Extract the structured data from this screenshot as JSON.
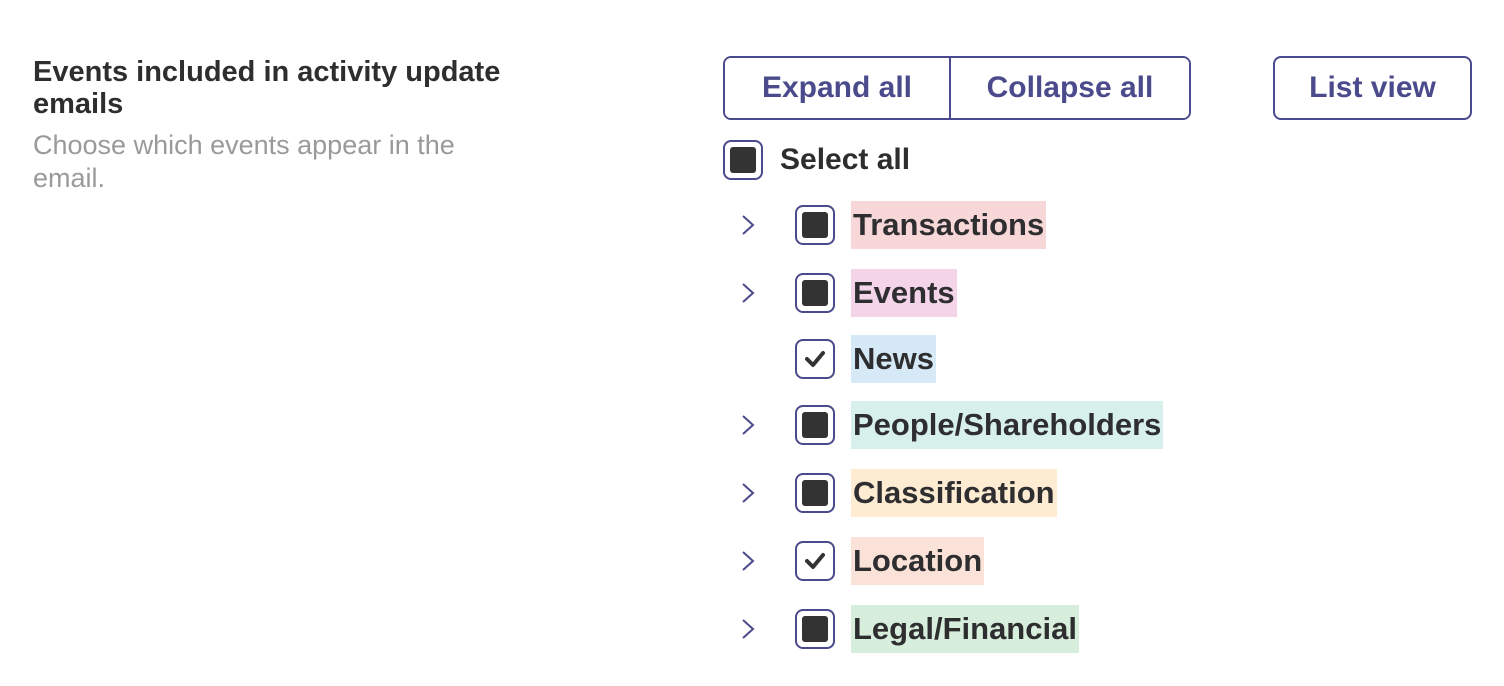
{
  "section": {
    "title": "Events included in activity update emails",
    "subtitle": "Choose which events appear in the email."
  },
  "toolbar": {
    "expand_all": "Expand all",
    "collapse_all": "Collapse all",
    "list_view": "List view"
  },
  "select_all": {
    "label": "Select all",
    "state": "indeterminate"
  },
  "colors": {
    "accent": "#4a4a8c",
    "text": "#2e2e30",
    "muted": "#9a9a9a"
  },
  "categories": [
    {
      "label": "Transactions",
      "state": "indeterminate",
      "expandable": true,
      "color": "#f8d7d8"
    },
    {
      "label": "Events",
      "state": "indeterminate",
      "expandable": true,
      "color": "#f3d4e8"
    },
    {
      "label": "News",
      "state": "checked",
      "expandable": false,
      "color": "#d6e9f6"
    },
    {
      "label": "People/Shareholders",
      "state": "indeterminate",
      "expandable": true,
      "color": "#d8f0ec"
    },
    {
      "label": "Classification",
      "state": "indeterminate",
      "expandable": true,
      "color": "#fdebd2"
    },
    {
      "label": "Location",
      "state": "checked",
      "expandable": true,
      "color": "#fbe2d8"
    },
    {
      "label": "Legal/Financial",
      "state": "indeterminate",
      "expandable": true,
      "color": "#d6eedb"
    }
  ]
}
